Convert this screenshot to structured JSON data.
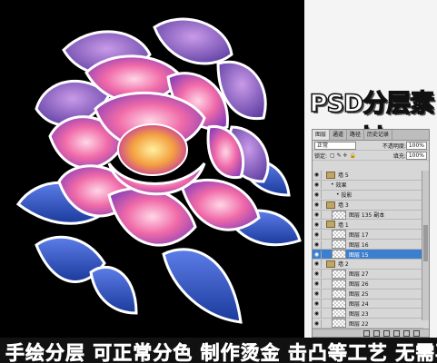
{
  "side_title": "PSD分层素材",
  "panel": {
    "tabs": [
      "图层",
      "通道",
      "路径",
      "历史记录"
    ],
    "blend_mode": "正常",
    "opacity_label": "不透明度:",
    "opacity_value": "100%",
    "lock_label": "锁定:",
    "fill_label": "填充:",
    "fill_value": "100%",
    "layers": [
      {
        "label": "墙 5",
        "kind": "folder",
        "indent": 0
      },
      {
        "label": "效果",
        "kind": "fx",
        "indent": 1
      },
      {
        "label": "投影",
        "kind": "fx",
        "indent": 2
      },
      {
        "label": "墙 3",
        "kind": "folder",
        "indent": 0
      },
      {
        "label": "图层 135 副本",
        "kind": "layer",
        "indent": 1
      },
      {
        "label": "墙 1",
        "kind": "folder",
        "indent": 0
      },
      {
        "label": "图层 17",
        "kind": "layer",
        "indent": 1
      },
      {
        "label": "图层 16",
        "kind": "layer",
        "indent": 1
      },
      {
        "label": "图层 15",
        "kind": "layer",
        "indent": 1,
        "selected": true
      },
      {
        "label": "墙 2",
        "kind": "folder",
        "indent": 0
      },
      {
        "label": "图层 27",
        "kind": "layer",
        "indent": 1
      },
      {
        "label": "图层 26",
        "kind": "layer",
        "indent": 1
      },
      {
        "label": "图层 25",
        "kind": "layer",
        "indent": 1
      },
      {
        "label": "图层 24",
        "kind": "layer",
        "indent": 1
      },
      {
        "label": "图层 23",
        "kind": "layer",
        "indent": 1
      },
      {
        "label": "图层 22",
        "kind": "layer",
        "indent": 1
      }
    ]
  },
  "banner_text": "手绘分层 可正常分色 制作烫金 击凸等工艺 无需再处理",
  "colors": {
    "accent_selected": "#3d7fcf",
    "background": "#000000"
  }
}
